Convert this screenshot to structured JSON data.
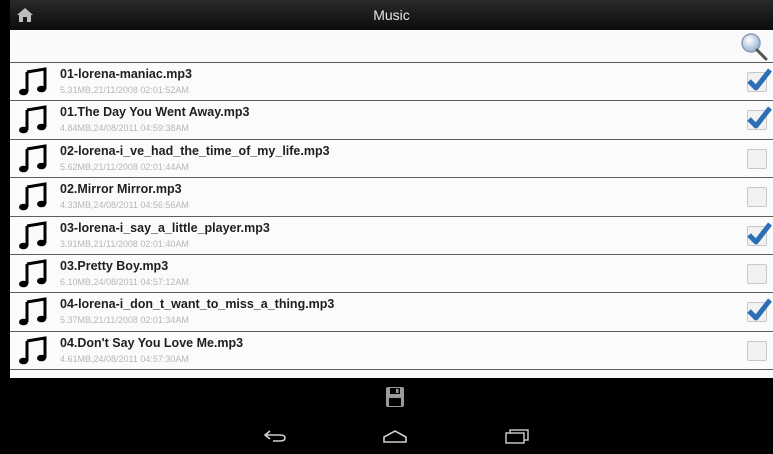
{
  "header": {
    "title": "Music",
    "home_icon": "home-icon"
  },
  "search": {
    "value": "",
    "icon": "search-icon"
  },
  "files": [
    {
      "name": "01-lorena-maniac.mp3",
      "meta": "5.31MB,21/11/2008 02:01:52AM",
      "checked": true
    },
    {
      "name": "01.The Day You Went Away.mp3",
      "meta": "4.84MB,24/08/2011 04:59:38AM",
      "checked": true
    },
    {
      "name": "02-lorena-i_ve_had_the_time_of_my_life.mp3",
      "meta": "5.62MB,21/11/2008 02:01:44AM",
      "checked": false
    },
    {
      "name": "02.Mirror Mirror.mp3",
      "meta": "4.33MB,24/08/2011 04:56:56AM",
      "checked": false
    },
    {
      "name": "03-lorena-i_say_a_little_player.mp3",
      "meta": "3.91MB,21/11/2008 02:01:40AM",
      "checked": true
    },
    {
      "name": "03.Pretty Boy.mp3",
      "meta": "6.10MB,24/08/2011 04:57:12AM",
      "checked": false
    },
    {
      "name": "04-lorena-i_don_t_want_to_miss_a_thing.mp3",
      "meta": "5.37MB,21/11/2008 02:01:34AM",
      "checked": true
    },
    {
      "name": "04.Don't Say You Love Me.mp3",
      "meta": "4.61MB,24/08/2011 04:57:30AM",
      "checked": false
    }
  ],
  "toolbar": {
    "save_icon": "save-icon"
  },
  "navbar": {
    "back_icon": "back-icon",
    "home_icon": "home-nav-icon",
    "recent_icon": "recent-apps-icon"
  },
  "colors": {
    "check": "#2d6fb6",
    "meta_text": "#b7b7b7",
    "divider": "#5e5e5e"
  }
}
